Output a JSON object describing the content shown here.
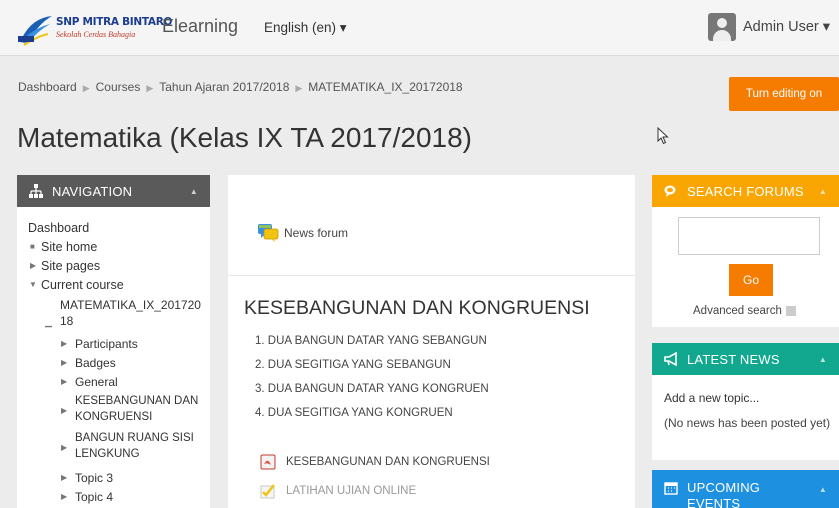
{
  "navbar": {
    "logo_title": "SNP MITRA BINTARO",
    "logo_sub": "Sekolah Cerdas Bahagia",
    "brand": "Elearning",
    "language": "English (en) ▾",
    "user_name": "Admin User ▾"
  },
  "breadcrumb": [
    "Dashboard",
    "Courses",
    "Tahun Ajaran 2017/2018",
    "MATEMATIKA_IX_20172018"
  ],
  "edit_button": "Turn editing on",
  "page_title": "Matematika (Kelas IX TA 2017/2018)",
  "navigation": {
    "title": "NAVIGATION",
    "dashboard": "Dashboard",
    "site_home": "Site home",
    "site_pages": "Site pages",
    "current_course": "Current course",
    "course_line1": "MATEMATIKA_IX_201720",
    "course_line2": "18",
    "participants": "Participants",
    "badges": "Badges",
    "general": "General",
    "topic_kese_1": "KESEBANGUNAN DAN",
    "topic_kese_2": "KONGRUENSI",
    "topic_bangun_1": "BANGUN RUANG SISI",
    "topic_bangun_2": "LENGKUNG",
    "topic3": "Topic 3",
    "topic4": "Topic 4"
  },
  "main": {
    "news_forum": "News forum",
    "section_title": "KESEBANGUNAN DAN KONGRUENSI",
    "topics": [
      "1. DUA BANGUN DATAR YANG SEBANGUN",
      "2. DUA SEGITIGA YANG SEBANGUN",
      "3. DUA BANGUN DATAR YANG KONGRUEN",
      "4. DUA SEGITIGA YANG KONGRUEN"
    ],
    "activity_file": "KESEBANGUNAN DAN KONGRUENSI",
    "activity_quiz": "LATIHAN UJIAN ONLINE"
  },
  "search_forums": {
    "title": "SEARCH FORUMS",
    "input_value": "",
    "go": "Go",
    "advanced": "Advanced search"
  },
  "latest_news": {
    "title": "LATEST NEWS",
    "add": "Add a new topic...",
    "none": "(No news has been posted yet)"
  },
  "upcoming": {
    "title": "UPCOMING EVENTS"
  },
  "colors": {
    "accent_orange": "#f57c00",
    "search_yellow": "#f9a602",
    "news_teal": "#11a88f",
    "events_blue": "#1e90e0",
    "nav_gray": "#5a5a5a"
  }
}
